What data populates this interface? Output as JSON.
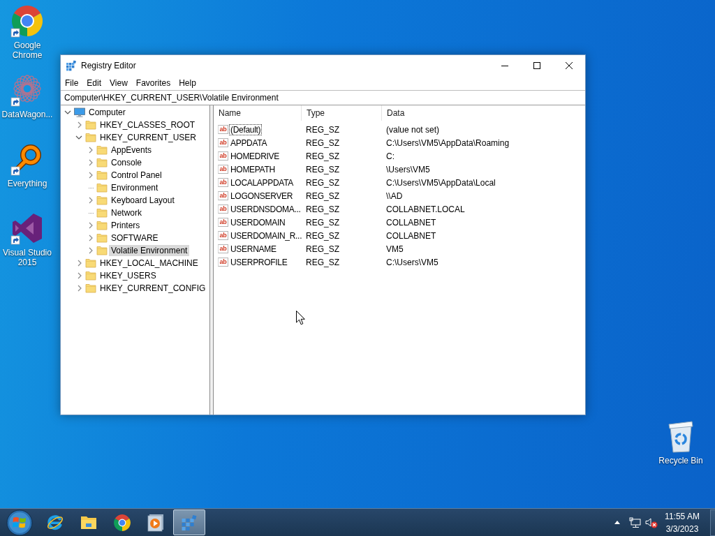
{
  "desktop": {
    "icons": [
      {
        "kind": "chrome",
        "label": "Google Chrome"
      },
      {
        "kind": "datawagon",
        "label": "DataWagon..."
      },
      {
        "kind": "everything",
        "label": "Everything"
      },
      {
        "kind": "visual-studio",
        "label": "Visual Studio 2015"
      }
    ],
    "recycle_bin": {
      "label": "Recycle Bin"
    }
  },
  "window": {
    "title": "Registry Editor",
    "menu": [
      "File",
      "Edit",
      "View",
      "Favorites",
      "Help"
    ],
    "address": "Computer\\HKEY_CURRENT_USER\\Volatile Environment",
    "tree": [
      {
        "label": "Computer",
        "kind": "computer",
        "expandable": true,
        "expanded": true,
        "selected": false,
        "children": [
          {
            "label": "HKEY_CLASSES_ROOT",
            "kind": "folder",
            "expandable": true,
            "expanded": false,
            "selected": false
          },
          {
            "label": "HKEY_CURRENT_USER",
            "kind": "folder",
            "expandable": true,
            "expanded": true,
            "selected": false,
            "children": [
              {
                "label": "AppEvents",
                "kind": "folder",
                "expandable": true,
                "expanded": false,
                "selected": false
              },
              {
                "label": "Console",
                "kind": "folder",
                "expandable": true,
                "expanded": false,
                "selected": false
              },
              {
                "label": "Control Panel",
                "kind": "folder",
                "expandable": true,
                "expanded": false,
                "selected": false
              },
              {
                "label": "Environment",
                "kind": "folder",
                "expandable": false,
                "selected": false
              },
              {
                "label": "Keyboard Layout",
                "kind": "folder",
                "expandable": true,
                "expanded": false,
                "selected": false
              },
              {
                "label": "Network",
                "kind": "folder",
                "expandable": false,
                "selected": false
              },
              {
                "label": "Printers",
                "kind": "folder",
                "expandable": true,
                "expanded": false,
                "selected": false
              },
              {
                "label": "SOFTWARE",
                "kind": "folder",
                "expandable": true,
                "expanded": false,
                "selected": false
              },
              {
                "label": "Volatile Environment",
                "kind": "folder",
                "expandable": true,
                "expanded": false,
                "selected": true
              }
            ]
          },
          {
            "label": "HKEY_LOCAL_MACHINE",
            "kind": "folder",
            "expandable": true,
            "expanded": false,
            "selected": false
          },
          {
            "label": "HKEY_USERS",
            "kind": "folder",
            "expandable": true,
            "expanded": false,
            "selected": false
          },
          {
            "label": "HKEY_CURRENT_CONFIG",
            "kind": "folder",
            "expandable": true,
            "expanded": false,
            "selected": false
          }
        ]
      }
    ],
    "table": {
      "columns": [
        "Name",
        "Type",
        "Data"
      ],
      "rows": [
        {
          "icon_text": "ab",
          "name": "(Default)",
          "type": "REG_SZ",
          "data": "(value not set)",
          "focused": true
        },
        {
          "icon_text": "ab",
          "name": "APPDATA",
          "type": "REG_SZ",
          "data": "C:\\Users\\VM5\\AppData\\Roaming",
          "focused": false
        },
        {
          "icon_text": "ab",
          "name": "HOMEDRIVE",
          "type": "REG_SZ",
          "data": "C:",
          "focused": false
        },
        {
          "icon_text": "ab",
          "name": "HOMEPATH",
          "type": "REG_SZ",
          "data": "\\Users\\VM5",
          "focused": false
        },
        {
          "icon_text": "ab",
          "name": "LOCALAPPDATA",
          "type": "REG_SZ",
          "data": "C:\\Users\\VM5\\AppData\\Local",
          "focused": false
        },
        {
          "icon_text": "ab",
          "name": "LOGONSERVER",
          "type": "REG_SZ",
          "data": "\\\\AD",
          "focused": false
        },
        {
          "icon_text": "ab",
          "name": "USERDNSDOMA...",
          "type": "REG_SZ",
          "data": "COLLABNET.LOCAL",
          "focused": false
        },
        {
          "icon_text": "ab",
          "name": "USERDOMAIN",
          "type": "REG_SZ",
          "data": "COLLABNET",
          "focused": false
        },
        {
          "icon_text": "ab",
          "name": "USERDOMAIN_R...",
          "type": "REG_SZ",
          "data": "COLLABNET",
          "focused": false
        },
        {
          "icon_text": "ab",
          "name": "USERNAME",
          "type": "REG_SZ",
          "data": "VM5",
          "focused": false
        },
        {
          "icon_text": "ab",
          "name": "USERPROFILE",
          "type": "REG_SZ",
          "data": "C:\\Users\\VM5",
          "focused": false
        }
      ]
    }
  },
  "taskbar": {
    "apps": [
      {
        "kind": "ie",
        "active": false
      },
      {
        "kind": "explorer",
        "active": false
      },
      {
        "kind": "chrome",
        "active": false
      },
      {
        "kind": "media-player",
        "active": false
      },
      {
        "kind": "regedit",
        "active": true
      }
    ],
    "tray": {
      "volume_muted": true,
      "time": "11:55 AM",
      "date": "3/3/2023"
    }
  }
}
